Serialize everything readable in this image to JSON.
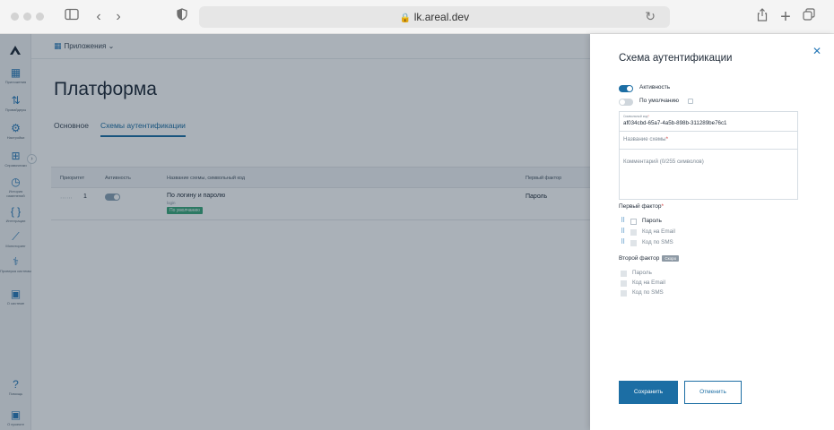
{
  "browser": {
    "url": "lk.areal.dev"
  },
  "topbar": {
    "apps_label": "Приложения"
  },
  "sidebar": {
    "items": [
      {
        "label": "Приложения",
        "icon": "apps-grid-icon"
      },
      {
        "label": "Провайдеры",
        "icon": "providers-icon"
      },
      {
        "label": "Настройки",
        "icon": "settings-icon"
      },
      {
        "label": "Справочники",
        "icon": "directories-icon"
      },
      {
        "label": "История изменений",
        "icon": "history-icon"
      },
      {
        "label": "Интеграции",
        "icon": "integrations-icon"
      },
      {
        "label": "Мониторинг",
        "icon": "monitoring-icon"
      },
      {
        "label": "Проверка системы",
        "icon": "system-check-icon"
      },
      {
        "label": "О системе",
        "icon": "about-system-icon"
      },
      {
        "label": "Помощь",
        "icon": "help-icon"
      },
      {
        "label": "О проекте",
        "icon": "about-project-icon"
      }
    ]
  },
  "page": {
    "title": "Платформа",
    "tabs": [
      {
        "label": "Основное",
        "active": false
      },
      {
        "label": "Схемы аутентификации",
        "active": true
      }
    ]
  },
  "table": {
    "headers": [
      "Приоритет",
      "Активность",
      "Название схемы, символьный код",
      "Первый фактор"
    ],
    "rows": [
      {
        "priority": "1",
        "active": true,
        "name": "По логину и паролю",
        "code": "login",
        "badge": "По умолчанию",
        "first_factor": "Пароль"
      }
    ]
  },
  "drawer": {
    "title": "Схема аутентификации",
    "toggles": [
      {
        "label": "Активность",
        "on": true
      },
      {
        "label": "По умолчанию",
        "on": false
      }
    ],
    "fields": {
      "code_label": "Символьный код",
      "code_value": "af034cbd-65a7-4a5b-898b-311289be76c1",
      "name_placeholder": "Название схемы",
      "comment_placeholder": "Комментарий (0/255 символов)"
    },
    "first_factor": {
      "label": "Первый фактор",
      "options": [
        {
          "label": "Пароль",
          "enabled": true
        },
        {
          "label": "Код на Email",
          "enabled": false
        },
        {
          "label": "Код по SMS",
          "enabled": false
        }
      ]
    },
    "second_factor": {
      "label": "Второй фактор",
      "badge": "Скоро",
      "options": [
        {
          "label": "Пароль"
        },
        {
          "label": "Код на Email"
        },
        {
          "label": "Код по SMS"
        }
      ]
    },
    "buttons": {
      "save": "Сохранить",
      "cancel": "Отменить"
    }
  },
  "colors": {
    "accent": "#1c6ea4",
    "badge_green": "#3aa87a",
    "required": "#d43a3a"
  }
}
